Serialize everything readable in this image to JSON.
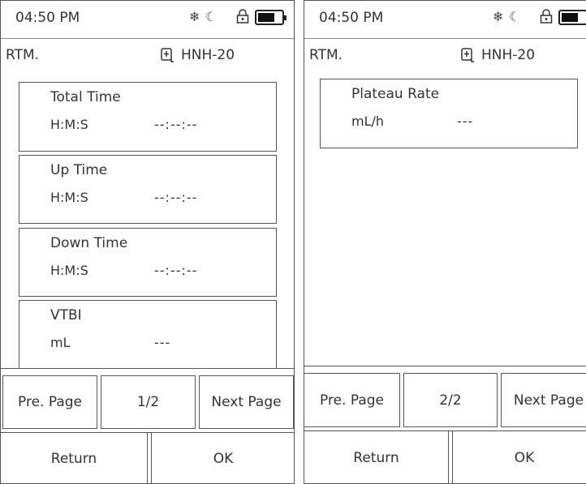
{
  "screens": [
    {
      "status": {
        "time": "04:50 PM",
        "icons": [
          "snowflake-icon",
          "night-mode-icon",
          "lock-icon",
          "battery-icon"
        ]
      },
      "header": {
        "mode": "RTM.",
        "device": "HNH-20"
      },
      "fields": [
        {
          "title": "Total Time",
          "unit": "H:M:S",
          "value": "--:--:--"
        },
        {
          "title": "Up Time",
          "unit": "H:M:S",
          "value": "--:--:--"
        },
        {
          "title": "Down Time",
          "unit": "H:M:S",
          "value": "--:--:--"
        },
        {
          "title": "VTBI",
          "unit": "mL",
          "value": "---"
        }
      ],
      "nav": {
        "prev": "Pre. Page",
        "page": "1/2",
        "next": "Next Page"
      },
      "actions": {
        "return": "Return",
        "ok": "OK"
      }
    },
    {
      "status": {
        "time": "04:50 PM",
        "icons": [
          "snowflake-icon",
          "night-mode-icon",
          "lock-icon",
          "battery-icon"
        ]
      },
      "header": {
        "mode": "RTM.",
        "device": "HNH-20"
      },
      "fields": [
        {
          "title": "Plateau Rate",
          "unit": "mL/h",
          "value": "---"
        }
      ],
      "nav": {
        "prev": "Pre. Page",
        "page": "2/2",
        "next": "Next Page"
      },
      "actions": {
        "return": "Return",
        "ok": "OK"
      }
    }
  ]
}
